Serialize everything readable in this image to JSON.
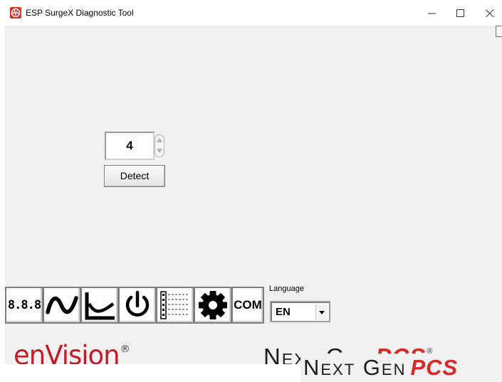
{
  "window": {
    "title": "ESP SurgeX Diagnostic Tool",
    "controls": {
      "minimize_glyph": "—",
      "maximize_glyph": "☐",
      "close_glyph": "✕"
    }
  },
  "numeric_control": {
    "value": "4"
  },
  "detect_button": {
    "label": "Detect"
  },
  "toolbar": {
    "buttons": [
      {
        "name": "seven-segment-display",
        "icon": "seven-segment-icon",
        "label": "8.8.8"
      },
      {
        "name": "waveform",
        "icon": "sine-wave-icon"
      },
      {
        "name": "chart",
        "icon": "curve-chart-icon"
      },
      {
        "name": "power",
        "icon": "power-icon"
      },
      {
        "name": "list",
        "icon": "list-icon"
      },
      {
        "name": "settings",
        "icon": "gear-icon"
      },
      {
        "name": "com-port",
        "label": "COM"
      }
    ]
  },
  "language": {
    "label": "Language",
    "selected": "EN"
  },
  "logos": {
    "envision": {
      "text": "enVision",
      "mark": "®"
    },
    "nextgen": {
      "word": "Next Gen",
      "accent": "PCS",
      "mark": "®"
    }
  },
  "colors": {
    "brand_red": "#c21c29",
    "accent_red": "#d42a2a",
    "client_bg": "#f0f0f0"
  }
}
